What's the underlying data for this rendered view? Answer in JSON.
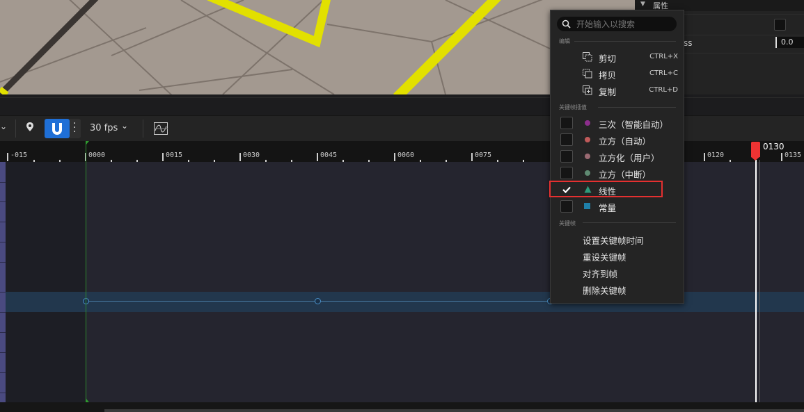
{
  "toolbar": {
    "fps": "30 fps"
  },
  "ruler": {
    "labels": [
      "-015",
      "0000",
      "0015",
      "0030",
      "0045",
      "0060",
      "0075",
      "0120",
      "0135"
    ],
    "playhead": "0130"
  },
  "properties": {
    "header": "属性",
    "partial_label": "ss",
    "value": "0.0"
  },
  "menu": {
    "search_placeholder": "开始输入以搜索",
    "section_edit": "编辑",
    "cut": "剪切",
    "cut_shortcut": "CTRL+X",
    "copy": "拷贝",
    "copy_shortcut": "CTRL+C",
    "duplicate": "复制",
    "duplicate_shortcut": "CTRL+D",
    "section_interp": "关键帧插值",
    "interp": [
      {
        "label": "三次（智能自动）",
        "checked": false,
        "color": "#8c2e8c"
      },
      {
        "label": "立方（自动）",
        "checked": false,
        "color": "#c05a5a"
      },
      {
        "label": "立方化（用户）",
        "checked": false,
        "color": "#9a6a72"
      },
      {
        "label": "立方（中断）",
        "checked": false,
        "color": "#5f8a72"
      },
      {
        "label": "线性",
        "checked": true,
        "color": "#2e9a7a"
      },
      {
        "label": "常量",
        "checked": false,
        "color": "#1f7fa8"
      }
    ],
    "section_keyframe": "关键帧",
    "set_time": "设置关键帧时间",
    "rekey": "重设关键帧",
    "snap": "对齐到帧",
    "delete": "删除关键帧"
  }
}
